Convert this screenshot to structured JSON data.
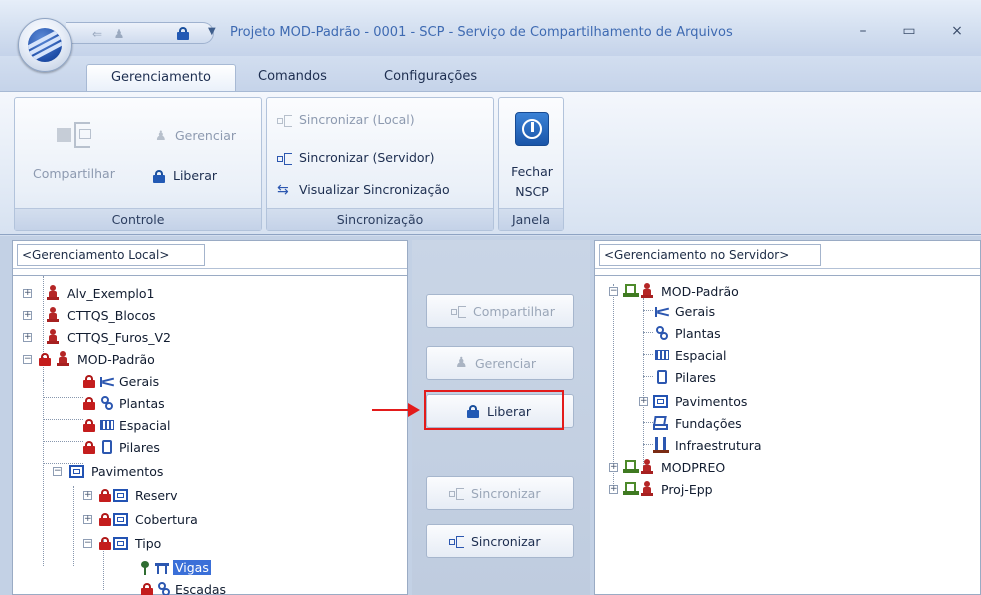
{
  "window": {
    "title": "Projeto MOD-Padrão - 0001 - SCP - Serviço de Compartilhamento de Arquivos",
    "minimize": "–",
    "maximize": "▭",
    "close": "×"
  },
  "tabs": [
    {
      "label": "Gerenciamento",
      "active": true
    },
    {
      "label": "Comandos",
      "active": false
    },
    {
      "label": "Configurações",
      "active": false
    }
  ],
  "ribbon": {
    "controle": {
      "label": "Controle",
      "compartilhar": "Compartilhar",
      "gerenciar": "Gerenciar",
      "liberar": "Liberar"
    },
    "sincronizacao": {
      "label": "Sincronização",
      "sync_local": "Sincronizar (Local)",
      "sync_servidor": "Sincronizar (Servidor)",
      "visualizar": "Visualizar Sincronização"
    },
    "janela": {
      "label": "Janela",
      "fechar_line1": "Fechar",
      "fechar_line2": "NSCP"
    }
  },
  "left_panel": {
    "combo": "<Gerenciamento Local>",
    "tree": {
      "alv": "Alv_Exemplo1",
      "blocos": "CTTQS_Blocos",
      "furos": "CTTQS_Furos_V2",
      "mod": "MOD-Padrão",
      "gerais": "Gerais",
      "plantas": "Plantas",
      "espacial": "Espacial",
      "pilares": "Pilares",
      "pavimentos": "Pavimentos",
      "reserv": "Reserv",
      "cobertura": "Cobertura",
      "tipo": "Tipo",
      "vigas": "Vigas",
      "escadas": "Escadas"
    }
  },
  "middle": {
    "compartilhar": "Compartilhar",
    "gerenciar": "Gerenciar",
    "liberar": "Liberar",
    "sincronizar_disabled": "Sincronizar",
    "sincronizar": "Sincronizar"
  },
  "right_panel": {
    "combo": "<Gerenciamento no Servidor>",
    "tree": {
      "mod": "MOD-Padrão",
      "gerais": "Gerais",
      "plantas": "Plantas",
      "espacial": "Espacial",
      "pilares": "Pilares",
      "pavimentos": "Pavimentos",
      "fundacoes": "Fundações",
      "infra": "Infraestrutura",
      "modpreo": "MODPREO",
      "proj": "Proj-Epp"
    }
  },
  "colors": {
    "accent": "#3e6ab2",
    "lock_red": "#c41d1d",
    "highlight_box": "#e31b1b",
    "selection": "#3a6fd8"
  }
}
